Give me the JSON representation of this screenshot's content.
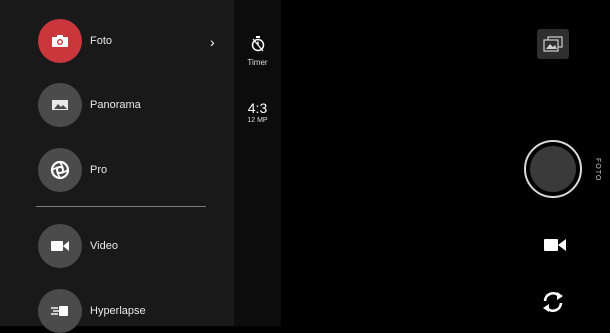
{
  "modes": [
    {
      "label": "Foto",
      "icon": "photo-camera-icon",
      "active": true
    },
    {
      "label": "Panorama",
      "icon": "panorama-icon",
      "active": false
    },
    {
      "label": "Pro",
      "icon": "aperture-icon",
      "active": false
    },
    {
      "label": "Video",
      "icon": "video-camera-icon",
      "active": false
    },
    {
      "label": "Hyperlapse",
      "icon": "hyperlapse-icon",
      "active": false
    }
  ],
  "settings": {
    "timer_label": "Timer",
    "ratio": "4:3",
    "megapixels": "12 MP"
  },
  "current_mode_label": "FOTO",
  "colors": {
    "active_mode": "#c9373c",
    "inactive_mode": "#4b4b4b",
    "menu_bg": "#191919",
    "strip_bg": "#0c0c0c"
  }
}
